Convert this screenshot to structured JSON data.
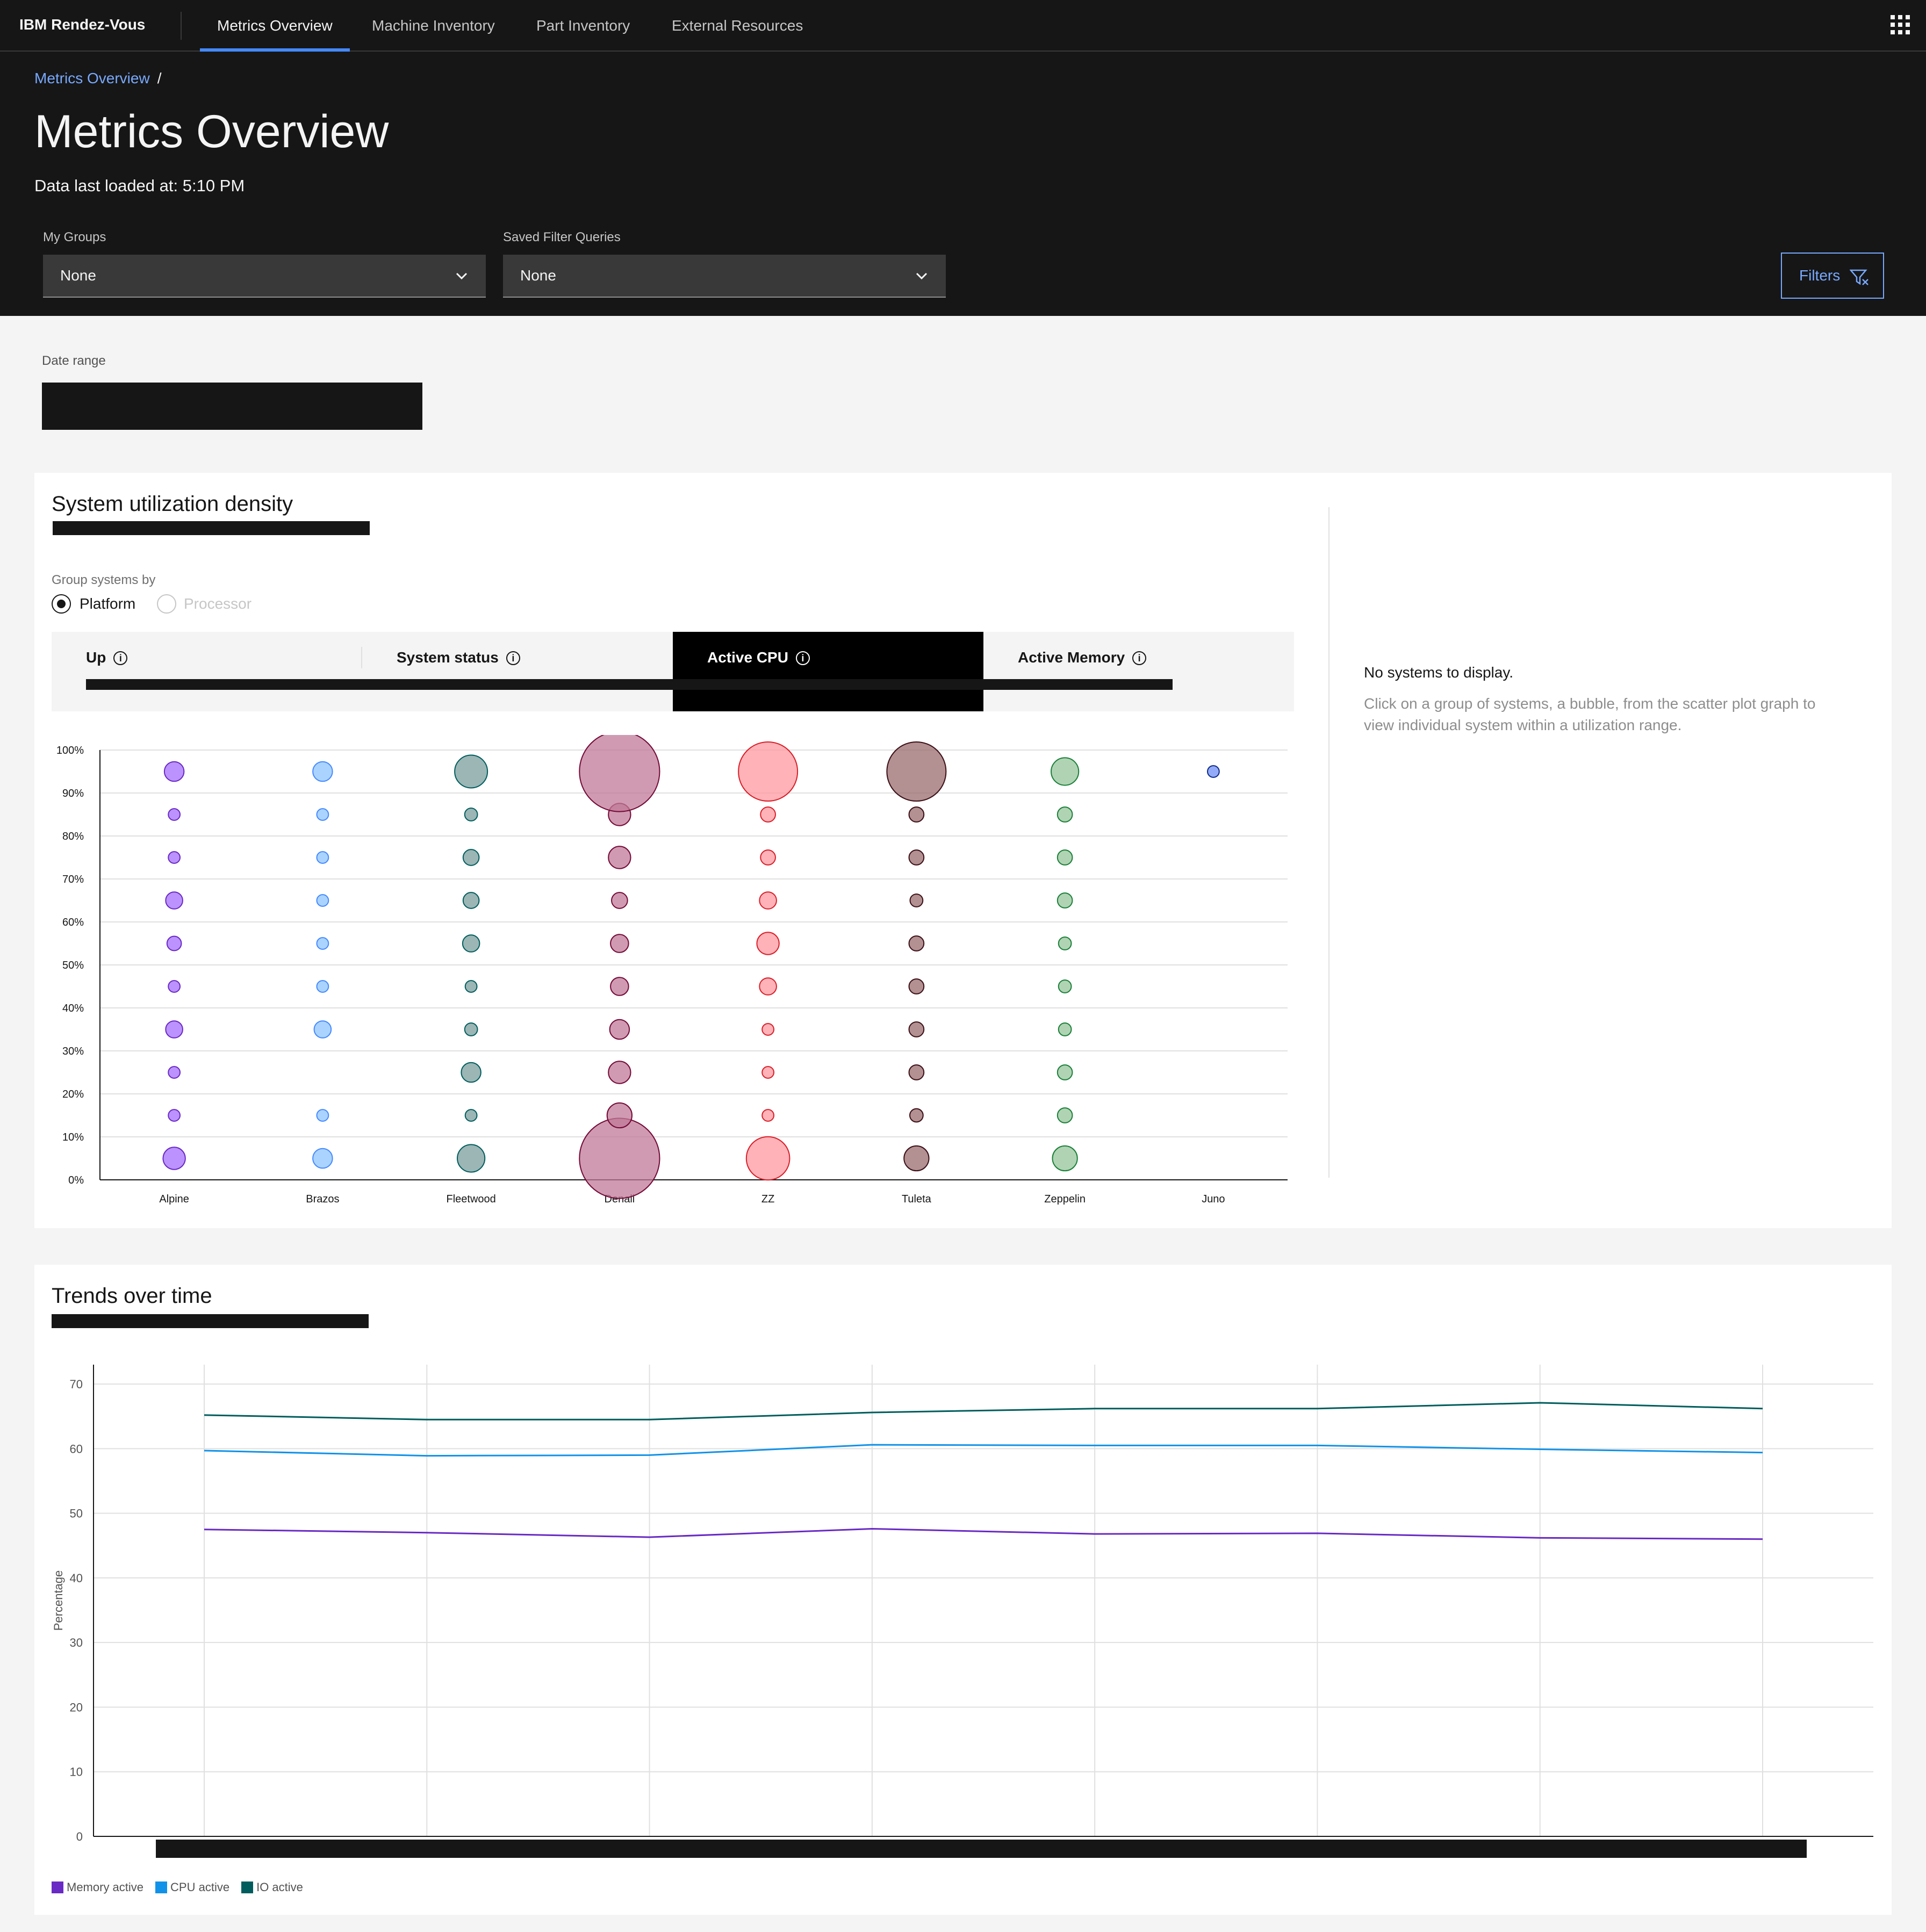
{
  "header": {
    "brand": "IBM Rendez-Vous",
    "nav": [
      "Metrics Overview",
      "Machine Inventory",
      "Part Inventory",
      "External Resources"
    ],
    "active_nav": "Metrics Overview"
  },
  "hero": {
    "breadcrumb": "Metrics Overview",
    "breadcrumb_sep": "/",
    "title": "Metrics Overview",
    "last_loaded": "Data last loaded at: 5:10 PM",
    "my_groups_label": "My Groups",
    "my_groups_value": "None",
    "saved_filter_label": "Saved Filter Queries",
    "saved_filter_value": "None",
    "filters_label": "Filters"
  },
  "date_range": {
    "label": "Date range"
  },
  "utilization": {
    "title": "System utilization density",
    "group_label": "Group systems by",
    "radio_platform": "Platform",
    "radio_processor": "Processor",
    "tabs": [
      "Up",
      "System status",
      "Active CPU",
      "Active Memory"
    ],
    "active_tab": "Active CPU",
    "info_glyph": "i",
    "empty_title": "No systems to display.",
    "empty_help": "Click on a group of systems, a bubble, from the scatter plot graph to view individual system within a utilization range."
  },
  "chart_data": [
    {
      "type": "scatter",
      "title": "System utilization density",
      "categories": [
        "Alpine",
        "Brazos",
        "Fleetwood",
        "Denali",
        "ZZ",
        "Tuleta",
        "Zeppelin",
        "Juno"
      ],
      "y_ticks": [
        "0%",
        "10%",
        "20%",
        "30%",
        "40%",
        "50%",
        "60%",
        "70%",
        "80%",
        "90%",
        "100%"
      ],
      "ylim": [
        0,
        100
      ],
      "bucket_centers": [
        5,
        15,
        25,
        35,
        45,
        55,
        65,
        75,
        85,
        95
      ],
      "series": [
        {
          "category": "Alpine",
          "color": "#a56eff",
          "stroke": "#6929c4",
          "sizes": [
            3,
            1,
            1,
            2,
            1,
            1.5,
            2,
            1,
            1,
            2.5
          ]
        },
        {
          "category": "Brazos",
          "color": "#8ec5ff",
          "stroke": "#4589ff",
          "sizes": [
            2.5,
            1,
            0,
            2,
            1,
            1,
            1,
            1,
            1,
            2.5
          ]
        },
        {
          "category": "Fleetwood",
          "color": "#7a9e9c",
          "stroke": "#005d5d",
          "sizes": [
            4,
            1,
            2.5,
            1.2,
            1,
            2,
            1.8,
            1.8,
            1.2,
            5
          ]
        },
        {
          "category": "Denali",
          "color": "#c07a98",
          "stroke": "#740937",
          "sizes": [
            14,
            3.5,
            3,
            2.5,
            2.2,
            2.2,
            1.8,
            3,
            3,
            14
          ]
        },
        {
          "category": "ZZ",
          "color": "#ff9aa2",
          "stroke": "#da1e28",
          "sizes": [
            7,
            1,
            1,
            1,
            2,
            3,
            2,
            1.6,
            1.6,
            10
          ]
        },
        {
          "category": "Tuleta",
          "color": "#9a6b6e",
          "stroke": "#3b0f16",
          "sizes": [
            3.5,
            1.3,
            1.6,
            1.6,
            1.6,
            1.6,
            1.2,
            1.6,
            1.6,
            10
          ]
        },
        {
          "category": "Zeppelin",
          "color": "#95c69a",
          "stroke": "#198038",
          "sizes": [
            3.5,
            1.6,
            1.6,
            1.2,
            1.2,
            1.2,
            1.6,
            1.6,
            1.6,
            4
          ]
        },
        {
          "category": "Juno",
          "color": "#6f8ef5",
          "stroke": "#0f2a8a",
          "sizes": [
            0,
            0,
            0,
            0,
            0,
            0,
            0,
            0,
            0,
            1
          ]
        }
      ]
    },
    {
      "type": "line",
      "title": "Trends over time",
      "ylabel": "Percentage",
      "y_ticks": [
        "0",
        "10",
        "20",
        "30",
        "40",
        "50",
        "60",
        "70"
      ],
      "ylim": [
        0,
        73
      ],
      "points": 8,
      "series": [
        {
          "name": "Memory active",
          "color": "#6929c4",
          "values": [
            47.5,
            47,
            46.3,
            47.6,
            46.8,
            46.9,
            46.2,
            46
          ]
        },
        {
          "name": "CPU active",
          "color": "#1192e8",
          "values": [
            59.7,
            58.9,
            59,
            60.6,
            60.5,
            60.5,
            59.9,
            59.4
          ]
        },
        {
          "name": "IO active",
          "color": "#005d5d",
          "values": [
            65.2,
            64.5,
            64.5,
            65.6,
            66.2,
            66.2,
            67.1,
            66.2
          ]
        }
      ]
    }
  ],
  "trends": {
    "title": "Trends over time"
  }
}
